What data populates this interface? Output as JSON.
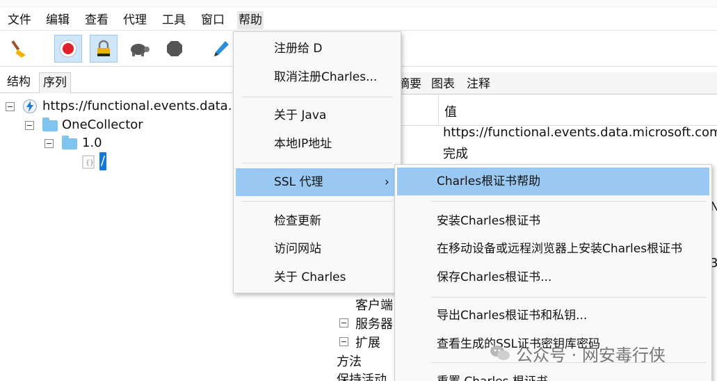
{
  "menubar": {
    "items": [
      "文件",
      "编辑",
      "查看",
      "代理",
      "工具",
      "窗口",
      "帮助"
    ]
  },
  "toolbar": {
    "buttons": [
      "broom-icon",
      "record-icon",
      "ssl-lock-icon",
      "turtle-icon",
      "stop-icon",
      "pen-icon"
    ]
  },
  "left_panel": {
    "tabs": [
      "结构",
      "序列"
    ],
    "tree": {
      "host": "https://functional.events.data.m",
      "folder1": "OneCollector",
      "folder2": "1.0",
      "leaf": "/"
    }
  },
  "right_panel": {
    "tabs": [
      "摘要",
      "图表",
      "注释"
    ],
    "header_value": "值",
    "row1_value": "https://functional.events.data.microsoft.com/O",
    "row2_value": "完成",
    "partial_right_1": "N",
    "partial_right_2": "3",
    "tree_rows": [
      "客户端",
      "服务器",
      "扩展",
      "方法",
      "保持活动"
    ]
  },
  "help_menu": {
    "items": [
      "注册给 D",
      "取消注册Charles...",
      "关于 Java",
      "本地IP地址",
      "SSL 代理",
      "检查更新",
      "访问网站",
      "关于 Charles"
    ],
    "submenu_arrow": "›"
  },
  "ssl_submenu": {
    "items": [
      "Charles根证书帮助",
      "安装Charles根证书",
      "在移动设备或远程浏览器上安装Charles根证书",
      "保存Charles根证书...",
      "导出Charles根证书和私钥...",
      "查看生成的SSL证书密钥库密码",
      "重置 Charles 根证书..."
    ]
  },
  "watermark": {
    "text": "公众号 · 网安毒行侠"
  },
  "colors": {
    "highlight": "#99c9f2",
    "selection": "#1177dd",
    "toolbar_pressed": "#cfe6f8"
  }
}
